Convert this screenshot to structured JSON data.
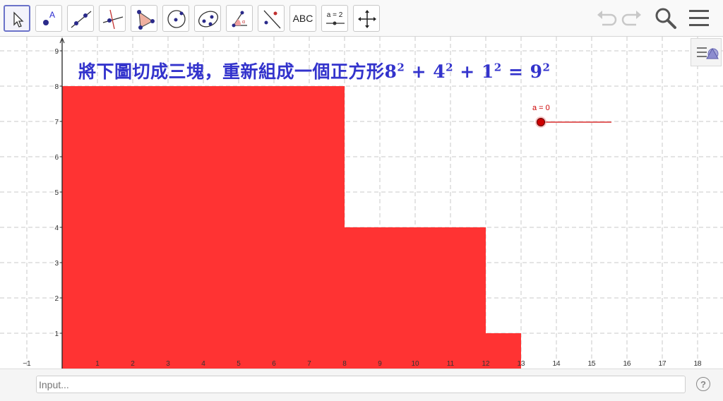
{
  "toolbar": {
    "tools": [
      {
        "name": "move-tool",
        "icon": "cursor-arrow-icon",
        "active": true
      },
      {
        "name": "point-tool",
        "icon": "point-a-icon"
      },
      {
        "name": "line-tool",
        "icon": "line-through-points-icon"
      },
      {
        "name": "perpendicular-tool",
        "icon": "perpendicular-line-icon"
      },
      {
        "name": "polygon-tool",
        "icon": "polygon-icon"
      },
      {
        "name": "circle-tool",
        "icon": "circle-center-point-icon"
      },
      {
        "name": "ellipse-tool",
        "icon": "ellipse-icon"
      },
      {
        "name": "angle-tool",
        "icon": "angle-icon"
      },
      {
        "name": "reflect-tool",
        "icon": "reflect-about-line-icon"
      },
      {
        "name": "text-tool",
        "label": "ABC"
      },
      {
        "name": "slider-tool",
        "label": "a = 2"
      },
      {
        "name": "move-graphics-tool",
        "icon": "move-arrows-icon"
      }
    ]
  },
  "title": {
    "text": "將下圖切成三塊，重新組成一個正方形",
    "formula_parts": [
      "8",
      "2",
      " + 4",
      "2",
      " + 1",
      "2",
      " = 9",
      "2"
    ]
  },
  "axes": {
    "x_ticks": [
      "−1",
      "1",
      "2",
      "3",
      "4",
      "5",
      "6",
      "7",
      "8",
      "9",
      "10",
      "11",
      "12",
      "13",
      "14",
      "15",
      "16",
      "17",
      "18"
    ],
    "y_ticks": [
      "1",
      "2",
      "3",
      "4",
      "5",
      "6",
      "7",
      "8",
      "9"
    ]
  },
  "shape": {
    "fill": "#ff3333",
    "vertices": [
      [
        0,
        0
      ],
      [
        0,
        8
      ],
      [
        8,
        8
      ],
      [
        8,
        4
      ],
      [
        12,
        4
      ],
      [
        12,
        1
      ],
      [
        13,
        1
      ],
      [
        13,
        0
      ]
    ]
  },
  "slider": {
    "label": "a = 0",
    "value": 0,
    "color": "#cc0000"
  },
  "input": {
    "placeholder": "Input..."
  },
  "help": {
    "label": "?"
  }
}
